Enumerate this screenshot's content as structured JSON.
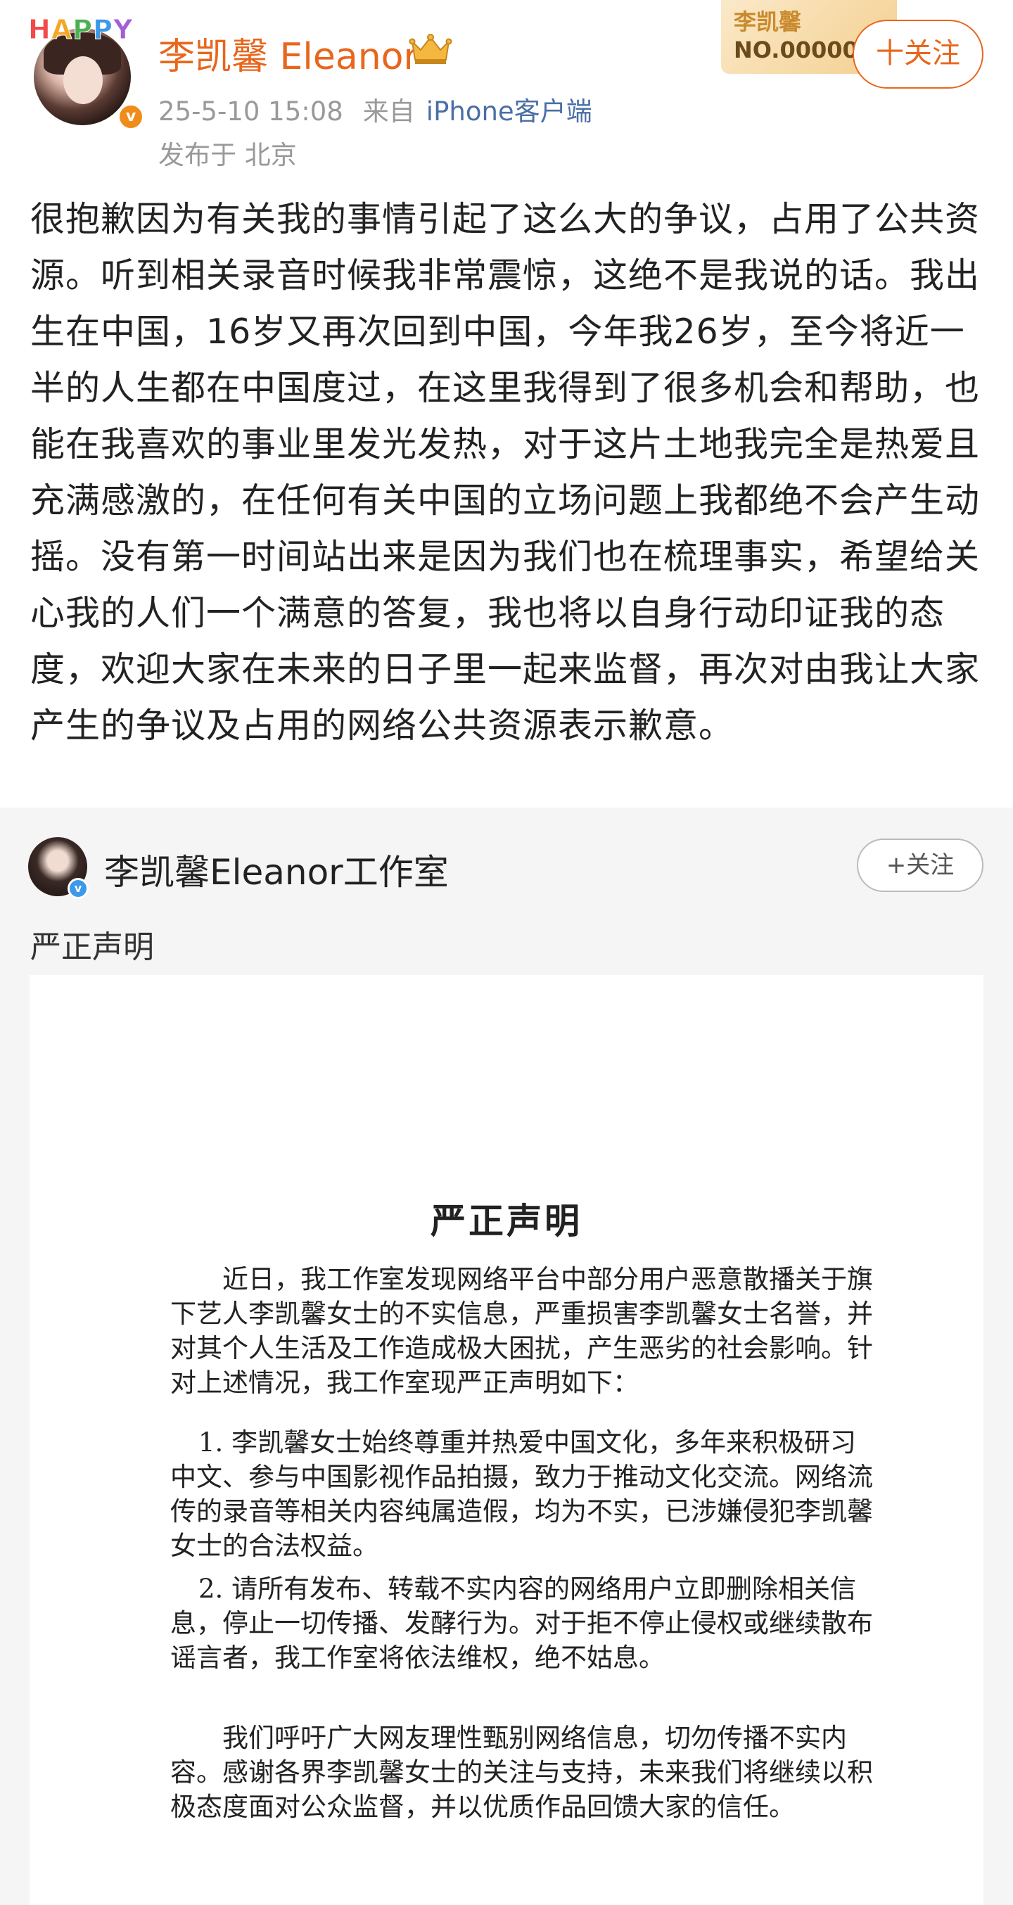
{
  "header": {
    "avatar_badge": "HAPPY",
    "username": "李凯馨 Eleanor",
    "timestamp": "25-5-10 15:08",
    "from_label": "来自",
    "source": "iPhone客户端",
    "location": "发布于 北京",
    "fan_card": {
      "name": "李凯馨",
      "number": "NO.000000"
    },
    "follow_label": "十关注"
  },
  "post": {
    "text": "很抱歉因为有关我的事情引起了这么大的争议，占用了公共资源。听到相关录音时候我非常震惊，这绝不是我说的话。我出生在中国，16岁又再次回到中国，今年我26岁，至今将近一半的人生都在中国度过，在这里我得到了很多机会和帮助，也能在我喜欢的事业里发光发热，对于这片土地我完全是热爱且充满感激的，在任何有关中国的立场问题上我都绝不会产生动摇。没有第一时间站出来是因为我们也在梳理事实，希望给关心我的人们一个满意的答复，我也将以自身行动印证我的态度，欢迎大家在未来的日子里一起来监督，再次对由我让大家产生的争议及占用的网络公共资源表示歉意。"
  },
  "repost": {
    "name": "李凯馨Eleanor工作室",
    "follow_label": "+关注",
    "title": "严正声明",
    "document": {
      "heading": "严正声明",
      "paragraphs": [
        "近日，我工作室发现网络平台中部分用户恶意散播关于旗下艺人李凯馨女士的不实信息，严重损害李凯馨女士名誉，并对其个人生活及工作造成极大困扰，产生恶劣的社会影响。针对上述情况，我工作室现严正声明如下：",
        "1. 李凯馨女士始终尊重并热爱中国文化，多年来积极研习中文、参与中国影视作品拍摄，致力于推动文化交流。网络流传的录音等相关内容纯属造假，均为不实，已涉嫌侵犯李凯馨女士的合法权益。",
        "2. 请所有发布、转载不实内容的网络用户立即删除相关信息，停止一切传播、发酵行为。对于拒不停止侵权或继续散布谣言者，我工作室将依法维权，绝不姑息。",
        "我们呼吁广大网友理性甄别网络信息，切勿传播不实内容。感谢各界李凯馨女士的关注与支持，未来我们将继续以积极态度面对公众监督，并以优质作品回馈大家的信任。"
      ]
    }
  },
  "colors": {
    "username": "#e8661c",
    "source_link": "#4a6fa5",
    "meta": "#999999",
    "repost_bg": "#f5f5f5"
  },
  "icons": [
    "verified-badge-icon",
    "crown-badge-icon",
    "blue-verified-icon"
  ]
}
